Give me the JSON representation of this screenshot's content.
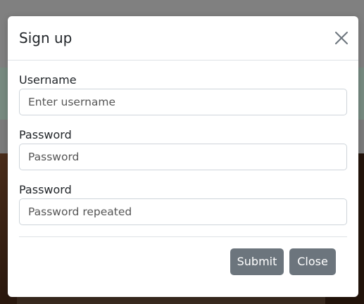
{
  "modal": {
    "title": "Sign up",
    "close_icon": "close-icon"
  },
  "form": {
    "username": {
      "label": "Username",
      "placeholder": "Enter username"
    },
    "password": {
      "label": "Password",
      "placeholder": "Password"
    },
    "password_repeat": {
      "label": "Password",
      "placeholder": "Password repeated"
    }
  },
  "footer": {
    "submit_label": "Submit",
    "close_label": "Close"
  },
  "colors": {
    "button_bg": "#6c757d",
    "overlay": "#7a7a7a"
  }
}
